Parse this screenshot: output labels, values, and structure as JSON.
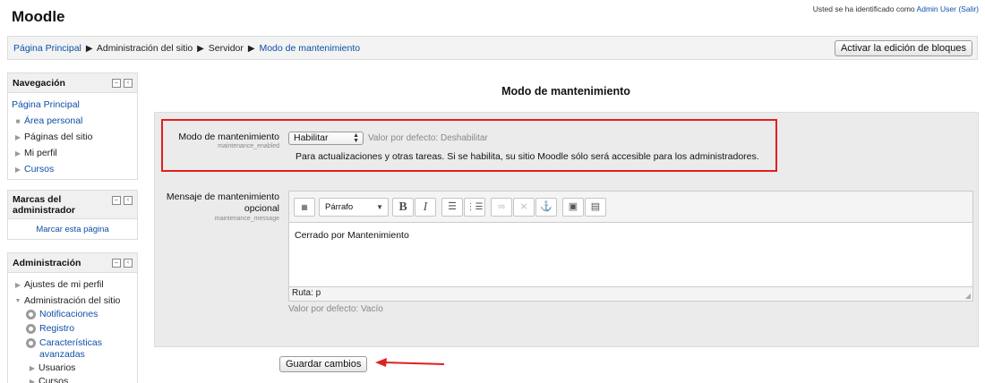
{
  "header": {
    "site_title": "Moodle",
    "login_prefix": "Usted se ha identificado como ",
    "login_user": "Admin User",
    "logout_link": "(Salir)"
  },
  "breadcrumb": {
    "items": [
      "Página Principal",
      "Administración del sitio",
      "Servidor",
      "Modo de mantenimiento"
    ],
    "separator": "▶"
  },
  "navbar": {
    "edit_button": "Activar la edición de bloques"
  },
  "blocks": {
    "navigation": {
      "title": "Navegación",
      "items": [
        "Página Principal",
        "Área personal",
        "Páginas del sitio",
        "Mi perfil",
        "Cursos"
      ]
    },
    "admin_bookmarks": {
      "title": "Marcas del administrador",
      "title_line1": "Marcas del",
      "title_line2": "administrador",
      "link": "Marcar esta página"
    },
    "administration": {
      "title": "Administración",
      "items": [
        "Ajustes de mi perfil",
        "Administración del sitio",
        "Notificaciones",
        "Registro",
        "Características avanzadas",
        "Usuarios",
        "Cursos"
      ],
      "caract_line1": "Características",
      "caract_line2": "avanzadas"
    }
  },
  "main": {
    "title": "Modo de mantenimiento",
    "maintenance": {
      "label": "Modo de mantenimiento",
      "sublabel": "maintenance_enabled",
      "selected": "Habilitar",
      "default": "Valor por defecto: Deshabilitar",
      "help": "Para actualizaciones y otras tareas. Si se habilita, su sitio Moodle sólo será accesible para los administradores."
    },
    "message": {
      "label": "Mensaje de mantenimiento opcional",
      "label_line1": "Mensaje de mantenimiento",
      "label_line2": "opcional",
      "sublabel": "maintenance_message",
      "format": "Párrafo",
      "content": "Cerrado por Mantenimiento",
      "path": "Ruta: p",
      "default": "Valor por defecto: Vacío"
    },
    "save_button": "Guardar cambios"
  },
  "colors": {
    "link": "#0d4fa8",
    "highlight_box": "#e02020",
    "annotation_arrow": "#e02020"
  }
}
